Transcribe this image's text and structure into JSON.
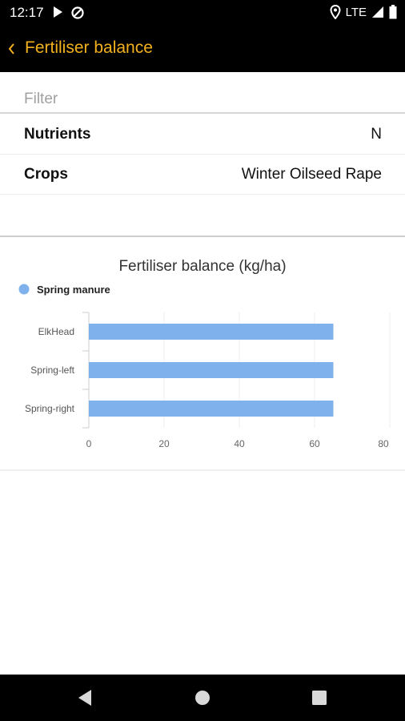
{
  "status_bar": {
    "time": "12:17",
    "network": "LTE",
    "left_icons": [
      "play-store-icon",
      "data-saver-icon"
    ],
    "right_icons": [
      "location-pin-icon",
      "signal-icon",
      "battery-icon"
    ]
  },
  "app_bar": {
    "back_icon": "chevron-left-icon",
    "title": "Fertiliser balance",
    "accent_color": "#f2b01e"
  },
  "filter": {
    "header": "Filter",
    "rows": [
      {
        "label": "Nutrients",
        "value": "N"
      },
      {
        "label": "Crops",
        "value": "Winter Oilseed Rape"
      }
    ]
  },
  "chart_data": {
    "type": "bar",
    "orientation": "horizontal",
    "title": "Fertiliser balance (kg/ha)",
    "categories": [
      "ElkHead",
      "Spring-left",
      "Spring-right"
    ],
    "series": [
      {
        "name": "Spring manure",
        "color": "#7fb2ec",
        "values": [
          65,
          65,
          65
        ]
      }
    ],
    "xlim": [
      0,
      80
    ],
    "xticks": [
      0,
      20,
      40,
      60,
      80
    ],
    "grid": true,
    "legend": "top-left"
  },
  "nav_bar": {
    "buttons": [
      "back-triangle-icon",
      "home-circle-icon",
      "recents-square-icon"
    ]
  }
}
